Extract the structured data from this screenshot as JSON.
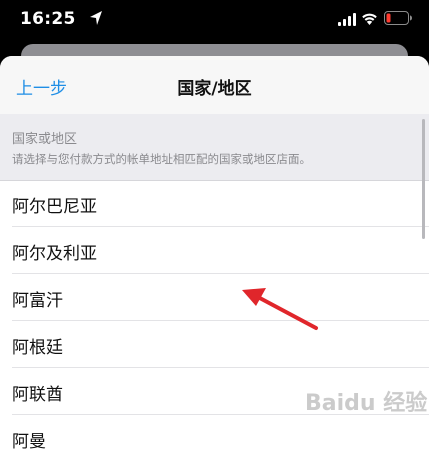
{
  "status_bar": {
    "time": "16:25"
  },
  "nav": {
    "back_label": "上一步",
    "title": "国家/地区"
  },
  "section": {
    "title": "国家或地区",
    "subtitle": "请选择与您付款方式的帐单地址相匹配的国家或地区店面。"
  },
  "countries": [
    "阿尔巴尼亚",
    "阿尔及利亚",
    "阿富汗",
    "阿根廷",
    "阿联酋",
    "阿曼"
  ],
  "watermark": "Baidu 经验",
  "colors": {
    "accent": "#1f8ee6",
    "annotation_arrow": "#e0262b"
  }
}
